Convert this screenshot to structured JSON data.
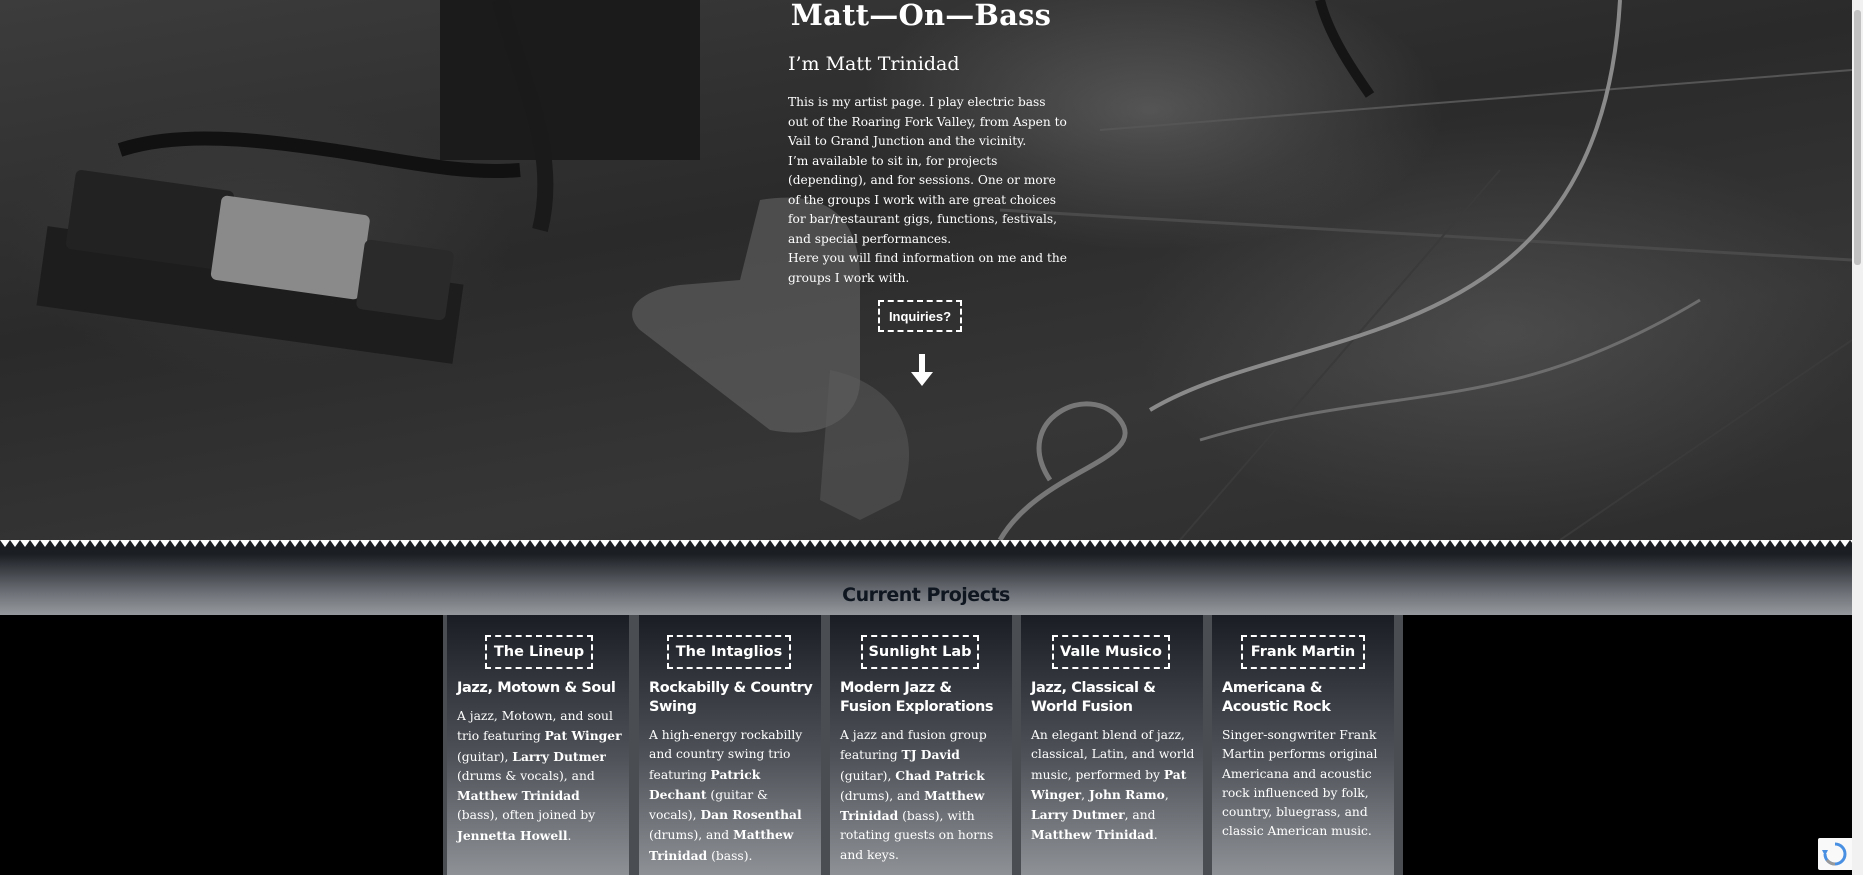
{
  "hero": {
    "site_title": "Matt—On—Bass",
    "heading": "I’m Matt Trinidad",
    "paragraphs": [
      "This is my artist page. I play electric bass out of the Roaring Fork Valley, from Aspen to Vail to Grand Junction and the vicinity.",
      "I’m available to sit in, for projects (depending), and for sessions. One or more of the groups I work with are great choices for bar/restaurant gigs, functions, festivals, and special performances.",
      "Here you will find information on me and the groups I work with."
    ],
    "inquiries_label": "Inquiries?",
    "scroll_icon": "down-arrow-icon"
  },
  "projects": {
    "title": "Current Projects",
    "cards": [
      {
        "name": "The Lineup",
        "genre": "Jazz, Motown & Soul",
        "desc_parts": [
          [
            "A jazz, Motown, and soul trio featuring ",
            false
          ],
          [
            "Pat Winger",
            true
          ],
          [
            " (guitar), ",
            false
          ],
          [
            "Larry Dutmer",
            true
          ],
          [
            " (drums & vocals), and ",
            false
          ],
          [
            "Matthew Trinidad",
            true
          ],
          [
            " (bass), often joined by ",
            false
          ],
          [
            "Jennetta Howell",
            true
          ],
          [
            ".",
            false
          ]
        ]
      },
      {
        "name": "The Intaglios",
        "genre": "Rockabilly & Country Swing",
        "desc_parts": [
          [
            "A high-energy rockabilly and country swing trio featuring ",
            false
          ],
          [
            "Patrick Dechant",
            true
          ],
          [
            " (guitar & vocals), ",
            false
          ],
          [
            "Dan Rosenthal",
            true
          ],
          [
            " (drums), and ",
            false
          ],
          [
            "Matthew Trinidad",
            true
          ],
          [
            " (bass).",
            false
          ]
        ]
      },
      {
        "name": "Sunlight Lab",
        "genre": "Modern Jazz & Fusion Explorations",
        "desc_parts": [
          [
            "A jazz and fusion group featuring ",
            false
          ],
          [
            "TJ David",
            true
          ],
          [
            " (guitar), ",
            false
          ],
          [
            "Chad Patrick",
            true
          ],
          [
            " (drums), and ",
            false
          ],
          [
            "Matthew Trinidad",
            true
          ],
          [
            " (bass), with rotating guests on horns and keys.",
            false
          ]
        ]
      },
      {
        "name": "Valle Musico",
        "genre": "Jazz, Classical & World Fusion",
        "desc_parts": [
          [
            "An elegant blend of jazz, classical, Latin, and world music, performed by ",
            false
          ],
          [
            "Pat Winger",
            true
          ],
          [
            ", ",
            false
          ],
          [
            "John Ramo",
            true
          ],
          [
            ", ",
            false
          ],
          [
            "Larry Dutmer",
            true
          ],
          [
            ", and ",
            false
          ],
          [
            "Matthew Trinidad",
            true
          ],
          [
            ".",
            false
          ]
        ]
      },
      {
        "name": "Frank Martin",
        "genre": "Americana & Acoustic Rock",
        "desc_parts": [
          [
            "Singer-songwriter Frank Martin performs original Americana and acoustic rock influenced by folk, country, bluegrass, and classic American music.",
            false
          ]
        ]
      }
    ]
  },
  "badge": {
    "icon": "recaptcha-icon"
  }
}
